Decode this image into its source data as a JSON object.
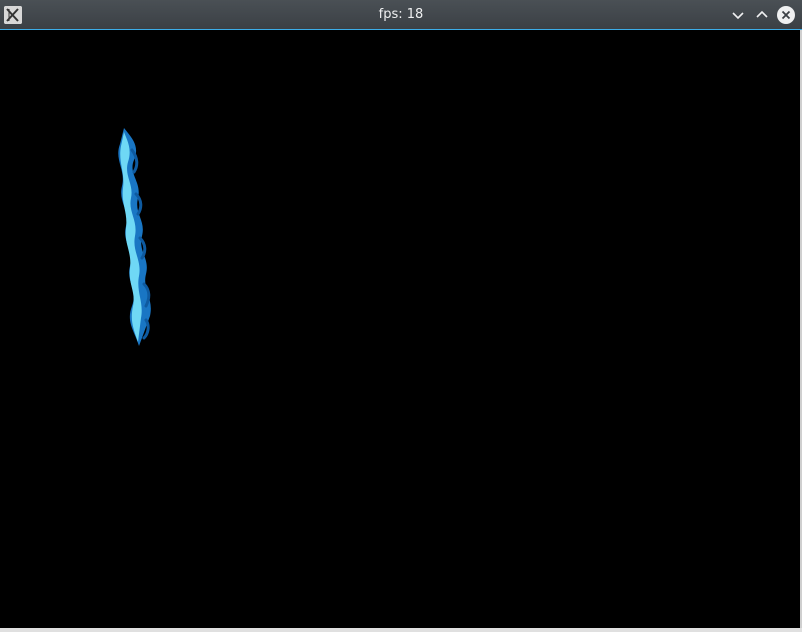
{
  "window": {
    "title": "fps: 18",
    "icon": "x-window-app-icon",
    "controls": [
      "minimize-icon",
      "maximize-icon",
      "close-icon"
    ],
    "accent_color": "#3daee9",
    "titlebar_color": "#3b4045"
  },
  "canvas": {
    "background": "#000000",
    "sprite": {
      "type": "wavy-blue-ribbon",
      "colors": [
        "#1976c4",
        "#6fd8f5",
        "#0e5aa0"
      ]
    }
  }
}
